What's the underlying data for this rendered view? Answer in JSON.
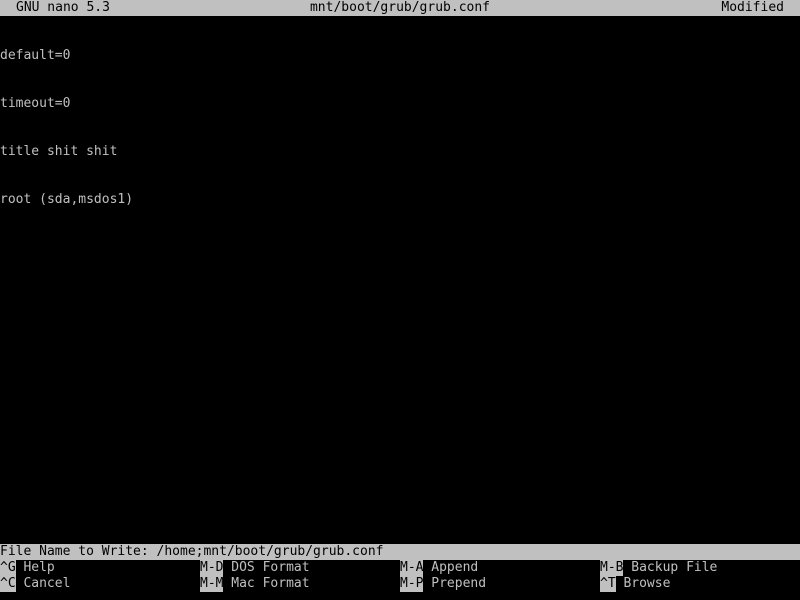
{
  "titlebar": {
    "app": "GNU nano 5.3",
    "filename": "mnt/boot/grub/grub.conf",
    "status": "Modified"
  },
  "editor": {
    "lines": [
      "default=0",
      "timeout=0",
      "title shit shit",
      "root (sda,msdos1)"
    ]
  },
  "prompt": {
    "label": "File Name to Write:",
    "value": "/home;mnt/boot/grub/grub.conf"
  },
  "shortcuts": [
    [
      {
        "key": "^G",
        "label": "Help"
      },
      {
        "key": "M-D",
        "label": "DOS Format"
      },
      {
        "key": "M-A",
        "label": "Append"
      },
      {
        "key": "M-B",
        "label": "Backup File"
      }
    ],
    [
      {
        "key": "^C",
        "label": "Cancel"
      },
      {
        "key": "M-M",
        "label": "Mac Format"
      },
      {
        "key": "M-P",
        "label": "Prepend"
      },
      {
        "key": "^T",
        "label": "Browse"
      }
    ]
  ]
}
